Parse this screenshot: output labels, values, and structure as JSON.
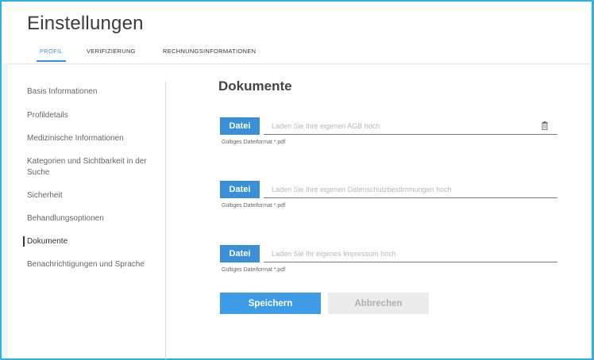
{
  "header": {
    "title": "Einstellungen",
    "tabs": [
      {
        "label": "PROFIL",
        "active": true
      },
      {
        "label": "VERIFIZIERUNG",
        "active": false
      },
      {
        "label": "RECHNUNGSINFORMATIONEN",
        "active": false
      }
    ]
  },
  "sidebar": {
    "items": [
      {
        "label": "Basis Informationen"
      },
      {
        "label": "Profildetails"
      },
      {
        "label": "Medizinische Informationen"
      },
      {
        "label": "Kategorien und Sichtbarkeit in der Suche"
      },
      {
        "label": "Sicherheit"
      },
      {
        "label": "Behandlungsoptionen"
      },
      {
        "label": "Dokumente",
        "active": true
      },
      {
        "label": "Benachrichtigungen und Sprache"
      }
    ]
  },
  "main": {
    "section_title": "Dokumente",
    "uploads": [
      {
        "button_label": "Datei",
        "placeholder": "Laden Sie Ihre eigenen AGB hoch",
        "hint": "Gültiges Dateiformat *.pdf",
        "icon": "trash-icon"
      },
      {
        "button_label": "Datei",
        "placeholder": "Laden Sie Ihre eigenen Datenschutzbestimmungen hoch",
        "hint": "Gültiges Dateiformat *.pdf"
      },
      {
        "button_label": "Datei",
        "placeholder": "Laden Sie Ihr eigenes Impressum hoch",
        "hint": "Gültiges Dateiformat *.pdf"
      }
    ],
    "save_label": "Speichern",
    "cancel_label": "Abbrechen"
  },
  "colors": {
    "accent": "#3a8fd6",
    "frame": "#2fb0e6",
    "cancel_bg": "#ececec"
  }
}
